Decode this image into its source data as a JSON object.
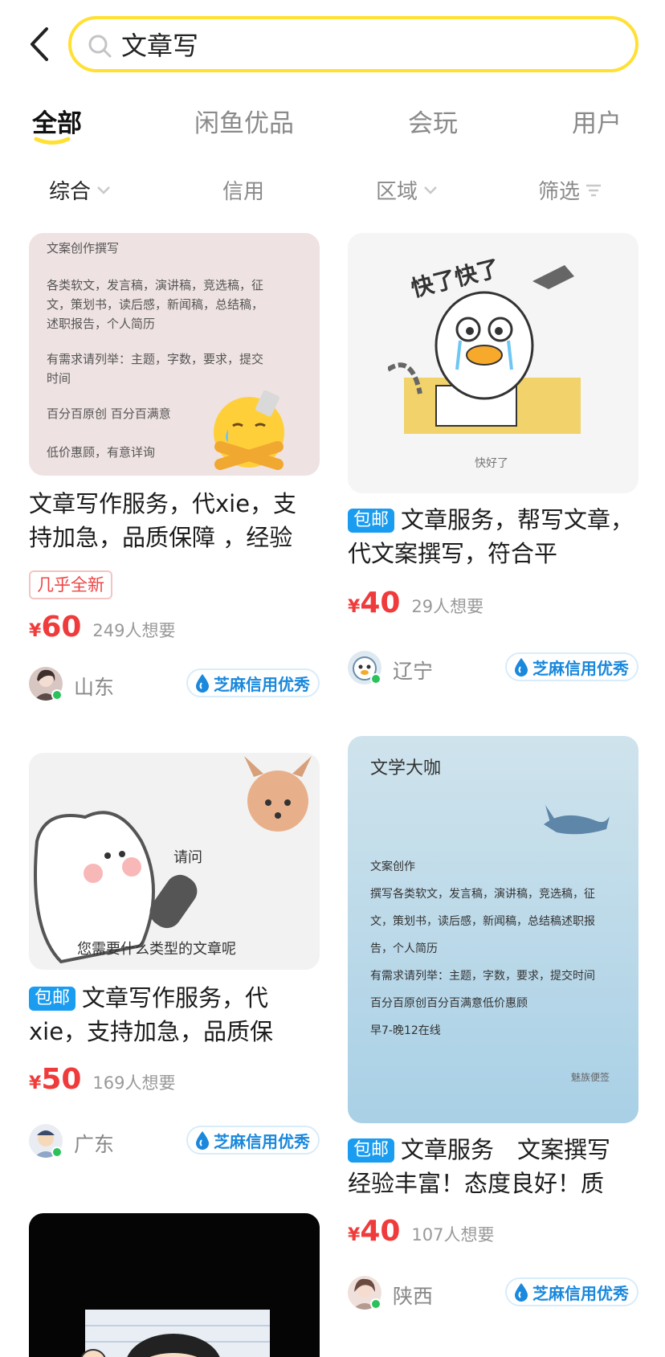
{
  "search": {
    "value": "文章写"
  },
  "tabs": [
    {
      "label": "全部"
    },
    {
      "label": "闲鱼优品"
    },
    {
      "label": "会玩"
    },
    {
      "label": "用户"
    }
  ],
  "sorts": [
    {
      "label": "综合"
    },
    {
      "label": "信用"
    },
    {
      "label": "区域"
    },
    {
      "label": "筛选"
    }
  ],
  "colors": {
    "accent": "#ffe033",
    "price": "#ef3b3b",
    "baoyou": "#1a9cf0",
    "zhima": "#1a88dc"
  },
  "products": [
    {
      "image_text": {
        "heading": "文案创作撰写",
        "line1": "各类软文，发言稿，演讲稿，竞选稿，征",
        "line2": "文，策划书，读后感，新闻稿，总结稿，",
        "line3": "述职报告，个人简历",
        "line4": "有需求请列举：主题，字数，要求，提交",
        "line5": "时间",
        "line6": "百分百原创 百分百满意",
        "line7": "低价惠顾，有意详询"
      },
      "badge": "",
      "title": "文章写作服务，代xie，支持加急，品质保障 ，经验",
      "condition": "几乎全新",
      "yen": "¥",
      "price": "60",
      "want": "249人想要",
      "region": "山东",
      "credit": "芝麻信用优秀"
    },
    {
      "image_text": {
        "top": "快了快了",
        "caption": "快好了"
      },
      "badge": "包邮",
      "title": "文章服务，帮写文章，代文案撰写，符合平",
      "yen": "¥",
      "price": "40",
      "want": "29人想要",
      "region": "辽宁",
      "credit": "芝麻信用优秀"
    },
    {
      "image_text": {
        "ask": "请问",
        "question": "您需要什么类型的文章呢"
      },
      "badge": "包邮",
      "title": "文章写作服务，代xie，支持加急，品质保",
      "yen": "¥",
      "price": "50",
      "want": "169人想要",
      "region": "广东",
      "credit": "芝麻信用优秀"
    },
    {
      "image_text": {
        "heading": "文学大咖",
        "line1": "文案创作",
        "line2": "撰写各类软文，发言稿，演讲稿，竞选稿，征",
        "line3": "文，策划书，读后感，新闻稿，总结稿述职报",
        "line4": "告，个人简历",
        "line5": "有需求请列举：主题，字数，要求，提交时间",
        "line6": "百分百原创百分百满意低价惠顾",
        "line7": "早7-晚12在线",
        "watermark": "魅族便签"
      },
      "badge": "包邮",
      "title": "文章服务　文案撰写 经验丰富！态度良好！质",
      "yen": "¥",
      "price": "40",
      "want": "107人想要",
      "region": "陕西",
      "credit": "芝麻信用优秀"
    }
  ]
}
